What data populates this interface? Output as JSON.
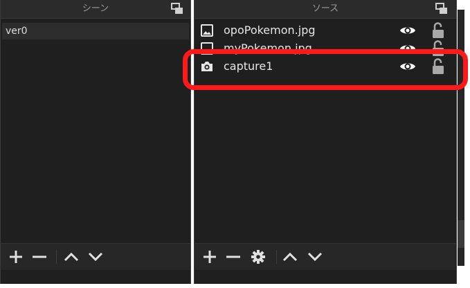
{
  "scenes_panel": {
    "title": "シーン",
    "items": [
      {
        "label": "ver0",
        "selected": true
      }
    ]
  },
  "sources_panel": {
    "title": "ソース",
    "items": [
      {
        "label": "opoPokemon.jpg",
        "icon": "image-icon",
        "visible": true,
        "locked": false
      },
      {
        "label": "myPokemon.jpg",
        "icon": "image-icon",
        "visible": true,
        "locked": false
      },
      {
        "label": "capture1",
        "icon": "camera-icon",
        "visible": true,
        "locked": false
      }
    ]
  },
  "highlighted_item": "capture1",
  "colors": {
    "panel_bg": "#1f1f1f",
    "header_bg": "#2b2b2b",
    "highlight": "#ff1a1a",
    "text": "#e6e6e6"
  }
}
